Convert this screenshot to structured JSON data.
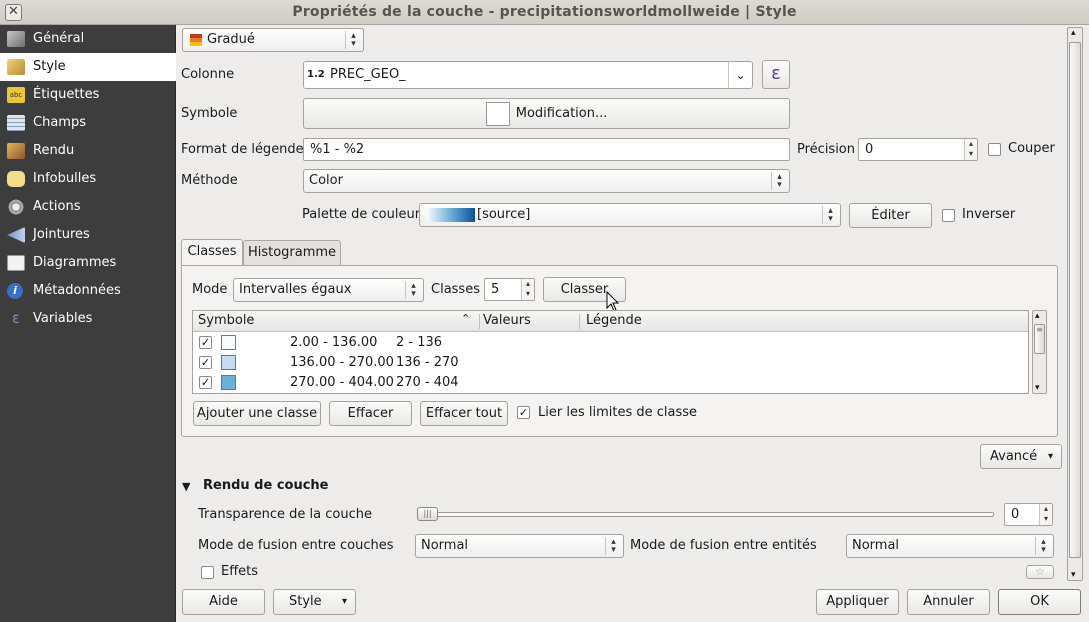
{
  "window": {
    "title": "Propriétés de la couche - precipitationsworldmollweide | Style"
  },
  "sidebar": {
    "items": [
      {
        "label": "Général",
        "icon": "tools-icon"
      },
      {
        "label": "Style",
        "icon": "paintbrush-icon"
      },
      {
        "label": "Étiquettes",
        "icon": "labels-icon"
      },
      {
        "label": "Champs",
        "icon": "table-icon"
      },
      {
        "label": "Rendu",
        "icon": "brush-icon"
      },
      {
        "label": "Infobulles",
        "icon": "speech-bubble-icon"
      },
      {
        "label": "Actions",
        "icon": "gear-icon"
      },
      {
        "label": "Jointures",
        "icon": "join-icon"
      },
      {
        "label": "Diagrammes",
        "icon": "diagram-icon"
      },
      {
        "label": "Métadonnées",
        "icon": "info-icon"
      },
      {
        "label": "Variables",
        "icon": "epsilon-icon"
      }
    ],
    "active": "Style"
  },
  "renderer": {
    "type_value": "Gradué",
    "column_label": "Colonne",
    "column_type_badge": "1.2",
    "column_value": "PREC_GEO_",
    "expression_icon": "ε",
    "symbol_label": "Symbole",
    "symbol_button": "Modification...",
    "legend_format_label": "Format de légende",
    "legend_format_value": "%1 - %2",
    "precision_label": "Précision",
    "precision_value": "0",
    "trim_label": "Couper",
    "method_label": "Méthode",
    "method_value": "Color",
    "palette_label": "Palette de couleur",
    "palette_value": "[source]",
    "edit_button": "Éditer",
    "invert_label": "Inverser"
  },
  "tabs": [
    {
      "label": "Classes",
      "active": true
    },
    {
      "label": "Histogramme",
      "active": false
    }
  ],
  "classes": {
    "mode_label": "Mode",
    "mode_value": "Intervalles égaux",
    "classes_label": "Classes",
    "classes_value": "5",
    "classify_button": "Classer",
    "table_headers": {
      "symbol": "Symbole",
      "values": "Valeurs",
      "legend": "Légende"
    },
    "rows": [
      {
        "checked": true,
        "color": "#f7fbff",
        "values": "2.00 - 136.00",
        "legend": "2 - 136"
      },
      {
        "checked": true,
        "color": "#c6dbef",
        "values": "136.00 - 270.00",
        "legend": "136 - 270"
      },
      {
        "checked": true,
        "color": "#6baed6",
        "values": "270.00 - 404.00",
        "legend": "270 - 404"
      }
    ],
    "add_class_button": "Ajouter une classe",
    "delete_button": "Effacer",
    "delete_all_button": "Effacer tout",
    "link_limits_label": "Lier les limites de classe",
    "link_limits_checked": true
  },
  "advanced_button": "Avancé",
  "layer_rendering": {
    "section_title": "Rendu de couche",
    "transparency_label": "Transparence de la couche",
    "transparency_value": "0",
    "transparency_fraction": 0,
    "layer_blend_label": "Mode de fusion entre couches",
    "layer_blend_value": "Normal",
    "feature_blend_label": "Mode de fusion entre entités",
    "feature_blend_value": "Normal",
    "effects_label": "Effets"
  },
  "footer": {
    "help_button": "Aide",
    "style_button": "Style",
    "apply_button": "Appliquer",
    "cancel_button": "Annuler",
    "ok_button": "OK"
  },
  "colors": {
    "sidebar_bg": "#3d3d3d",
    "palette_start": "#f7fbff",
    "palette_end": "#08519c"
  }
}
